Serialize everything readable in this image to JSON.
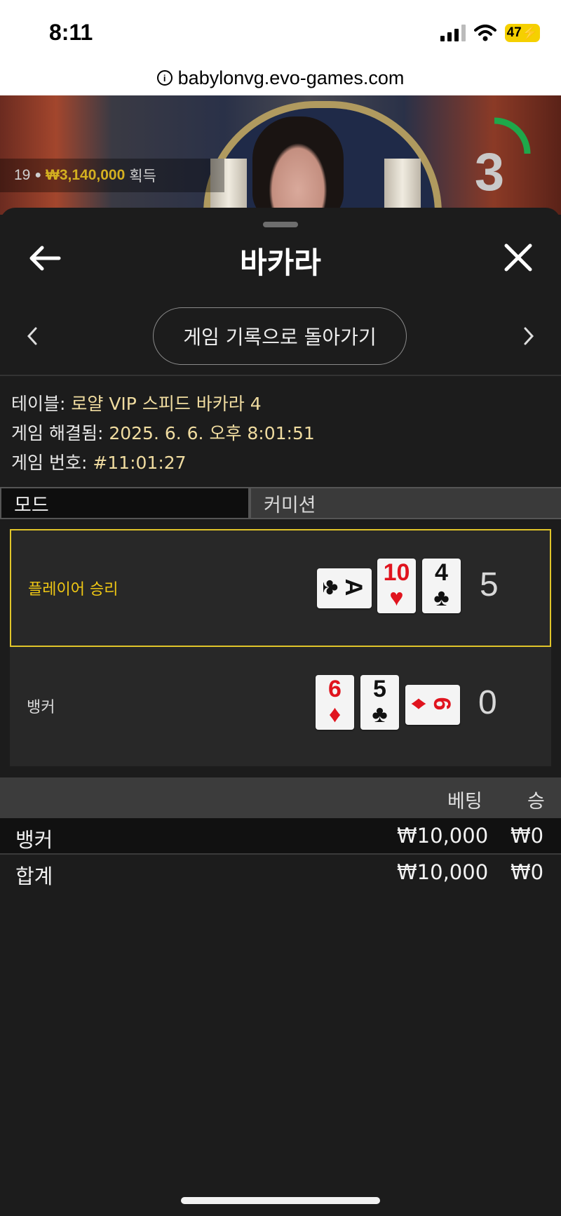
{
  "status_bar": {
    "time": "8:11",
    "battery": "47"
  },
  "browser": {
    "url": "babylonvg.evo-games.com"
  },
  "video": {
    "winners_count": "19",
    "winners_amount": "₩3,140,000",
    "winners_suffix": "획득",
    "countdown": "3"
  },
  "sheet": {
    "title": "바카라",
    "return_button": "게임 기록으로 돌아가기",
    "info": {
      "table_label": "테이블: ",
      "table_value": "로얄 VIP 스피드 바카라 4",
      "resolved_label": "게임 해결됨: ",
      "resolved_value": "2025. 6. 6. 오후 8:01:51",
      "number_label": "게임 번호: ",
      "number_value": "#11:01:27"
    },
    "tabs": [
      {
        "label": "모드",
        "active": true
      },
      {
        "label": "커미션",
        "active": false
      }
    ],
    "results": {
      "player": {
        "label": "플레이어 승리",
        "score": "5",
        "cards": [
          {
            "rank": "A",
            "suit": "♣",
            "color": "#111111",
            "orientation": "horizontal"
          },
          {
            "rank": "10",
            "suit": "♥",
            "color": "#e0141e",
            "orientation": "vertical"
          },
          {
            "rank": "4",
            "suit": "♣",
            "color": "#111111",
            "orientation": "vertical"
          }
        ]
      },
      "banker": {
        "label": "뱅커",
        "score": "0",
        "cards": [
          {
            "rank": "6",
            "suit": "♦",
            "color": "#e0141e",
            "orientation": "vertical"
          },
          {
            "rank": "5",
            "suit": "♣",
            "color": "#111111",
            "orientation": "vertical"
          },
          {
            "rank": "6",
            "suit": "♦",
            "color": "#e0141e",
            "orientation": "horizontal"
          }
        ]
      }
    },
    "bets": {
      "col_bet": "베팅",
      "col_win": "승",
      "rows": [
        {
          "name": "뱅커",
          "bet": "₩10,000",
          "win": "₩0"
        }
      ],
      "total": {
        "name": "합계",
        "bet": "₩10,000",
        "win": "₩0"
      }
    }
  },
  "colors": {
    "accent": "#f0c814",
    "winner_border": "#e1c52a",
    "sheet_bg": "#1c1c1c",
    "info_value": "#f0dca0"
  }
}
